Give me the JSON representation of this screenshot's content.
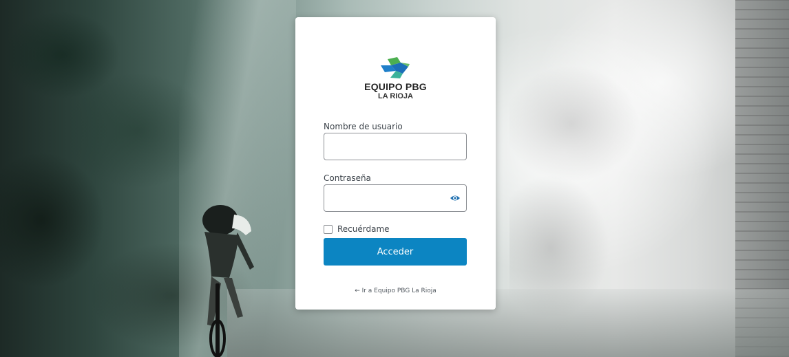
{
  "brand": {
    "title": "EQUIPO PBG",
    "subtitle": "LA RIOJA",
    "colors": {
      "green": "#4caf50",
      "blue": "#1f7fc9",
      "teal": "#3bb29a"
    }
  },
  "form": {
    "username_label": "Nombre de usuario",
    "username_value": "",
    "password_label": "Contraseña",
    "password_value": "",
    "remember_label": "Recuérdame",
    "remember_checked": false,
    "submit_label": "Acceder"
  },
  "footer": {
    "back_link": "← Ir a Equipo PBG La Rioja"
  },
  "colors": {
    "accent": "#0c85c2"
  },
  "icons": {
    "show_password": "eye-icon"
  }
}
